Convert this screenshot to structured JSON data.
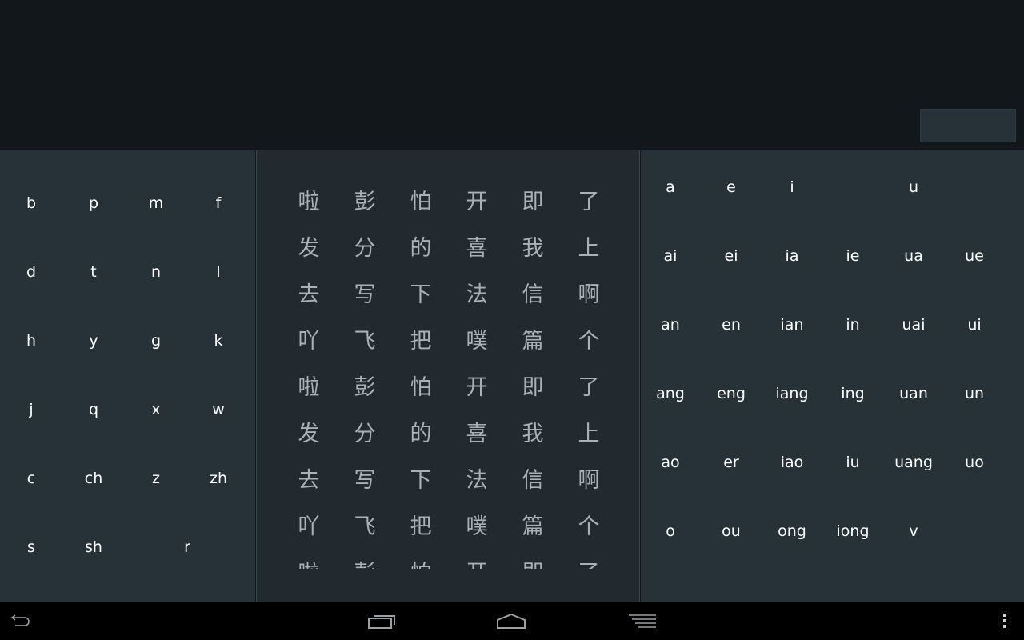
{
  "colors": {
    "top_background": "#12171b",
    "panel_background": "#263238",
    "middle_panel_background": "#222a2f",
    "key_text": "#ffffff",
    "character_text": "#a9b1b5",
    "navbar_background": "#000000"
  },
  "initials": {
    "rows": [
      [
        "b",
        "p",
        "m",
        "f"
      ],
      [
        "d",
        "t",
        "n",
        "l"
      ],
      [
        "h",
        "y",
        "g",
        "k"
      ],
      [
        "j",
        "q",
        "x",
        "w"
      ],
      [
        "c",
        "ch",
        "z",
        "zh"
      ],
      [
        "s",
        "sh",
        "r"
      ]
    ]
  },
  "characters": {
    "rows": [
      [
        "啦",
        "彭",
        "怕",
        "开",
        "即",
        "了"
      ],
      [
        "发",
        "分",
        "的",
        "喜",
        "我",
        "上"
      ],
      [
        "去",
        "写",
        "下",
        "法",
        "信",
        "啊"
      ],
      [
        "吖",
        "飞",
        "把",
        "噗",
        "篇",
        "个"
      ],
      [
        "啦",
        "彭",
        "怕",
        "开",
        "即",
        "了"
      ],
      [
        "发",
        "分",
        "的",
        "喜",
        "我",
        "上"
      ],
      [
        "去",
        "写",
        "下",
        "法",
        "信",
        "啊"
      ],
      [
        "吖",
        "飞",
        "把",
        "噗",
        "篇",
        "个"
      ],
      [
        "啦",
        "彭",
        "怕",
        "开",
        "即",
        "了"
      ]
    ]
  },
  "finals": {
    "rows": [
      [
        "a",
        "e",
        "i",
        "u"
      ],
      [
        "ai",
        "ei",
        "ia",
        "ie",
        "ua",
        "ue"
      ],
      [
        "an",
        "en",
        "ian",
        "in",
        "uai",
        "ui"
      ],
      [
        "ang",
        "eng",
        "iang",
        "ing",
        "uan",
        "un"
      ],
      [
        "ao",
        "er",
        "iao",
        "iu",
        "uang",
        "uo"
      ],
      [
        "o",
        "ou",
        "ong",
        "iong",
        "v"
      ]
    ]
  },
  "navbar": {
    "icons": [
      "back-icon",
      "recent-apps-icon",
      "home-icon",
      "menu-lines-icon",
      "overflow-menu-icon"
    ]
  }
}
